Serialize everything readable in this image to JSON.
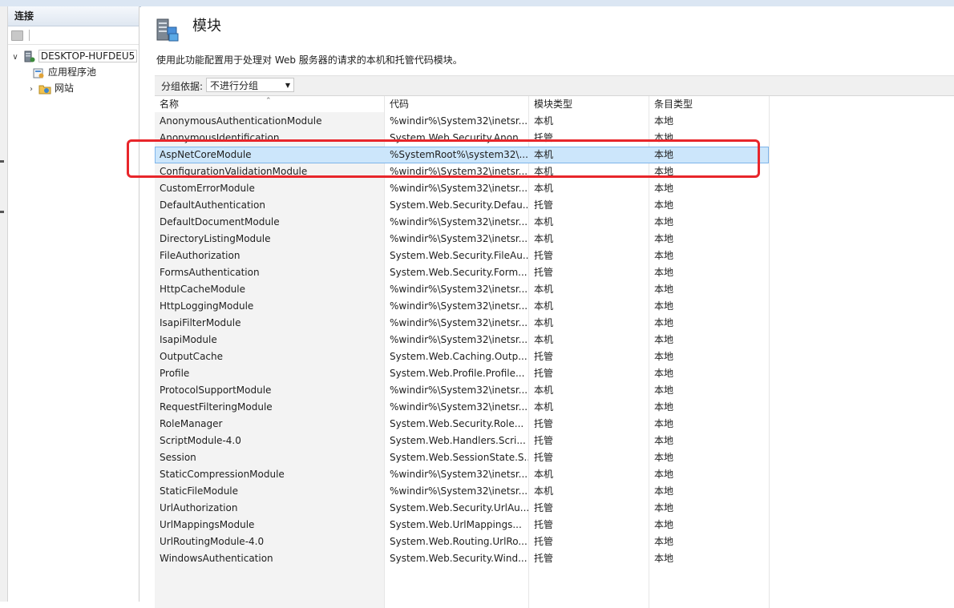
{
  "connections": {
    "title": "连接",
    "tree": [
      {
        "label": "DESKTOP-HUFDEU5",
        "expander": "∨"
      },
      {
        "label": "应用程序池",
        "expander": ""
      },
      {
        "label": "网站",
        "expander": "›"
      }
    ]
  },
  "page": {
    "title": "模块",
    "description": "使用此功能配置用于处理对 Web 服务器的请求的本机和托管代码模块。"
  },
  "grouping": {
    "label": "分组依据:",
    "selected": "不进行分组",
    "arrow": "▼"
  },
  "table": {
    "columns": [
      "名称",
      "代码",
      "模块类型",
      "条目类型"
    ],
    "sort_indicator": "⌃",
    "rows": [
      {
        "name": "AnonymousAuthenticationModule",
        "code": "%windir%\\System32\\inetsr...",
        "module_type": "本机",
        "entry_type": "本地"
      },
      {
        "name": "AnonymousIdentification",
        "code": "System.Web.Security.Anon...",
        "module_type": "托管",
        "entry_type": "本地"
      },
      {
        "name": "AspNetCoreModule",
        "code": "%SystemRoot%\\system32\\...",
        "module_type": "本机",
        "entry_type": "本地"
      },
      {
        "name": "ConfigurationValidationModule",
        "code": "%windir%\\System32\\inetsr...",
        "module_type": "本机",
        "entry_type": "本地"
      },
      {
        "name": "CustomErrorModule",
        "code": "%windir%\\System32\\inetsr...",
        "module_type": "本机",
        "entry_type": "本地"
      },
      {
        "name": "DefaultAuthentication",
        "code": "System.Web.Security.Defau...",
        "module_type": "托管",
        "entry_type": "本地"
      },
      {
        "name": "DefaultDocumentModule",
        "code": "%windir%\\System32\\inetsr...",
        "module_type": "本机",
        "entry_type": "本地"
      },
      {
        "name": "DirectoryListingModule",
        "code": "%windir%\\System32\\inetsr...",
        "module_type": "本机",
        "entry_type": "本地"
      },
      {
        "name": "FileAuthorization",
        "code": "System.Web.Security.FileAu...",
        "module_type": "托管",
        "entry_type": "本地"
      },
      {
        "name": "FormsAuthentication",
        "code": "System.Web.Security.Form...",
        "module_type": "托管",
        "entry_type": "本地"
      },
      {
        "name": "HttpCacheModule",
        "code": "%windir%\\System32\\inetsr...",
        "module_type": "本机",
        "entry_type": "本地"
      },
      {
        "name": "HttpLoggingModule",
        "code": "%windir%\\System32\\inetsr...",
        "module_type": "本机",
        "entry_type": "本地"
      },
      {
        "name": "IsapiFilterModule",
        "code": "%windir%\\System32\\inetsr...",
        "module_type": "本机",
        "entry_type": "本地"
      },
      {
        "name": "IsapiModule",
        "code": "%windir%\\System32\\inetsr...",
        "module_type": "本机",
        "entry_type": "本地"
      },
      {
        "name": "OutputCache",
        "code": "System.Web.Caching.Outp...",
        "module_type": "托管",
        "entry_type": "本地"
      },
      {
        "name": "Profile",
        "code": "System.Web.Profile.Profile...",
        "module_type": "托管",
        "entry_type": "本地"
      },
      {
        "name": "ProtocolSupportModule",
        "code": "%windir%\\System32\\inetsr...",
        "module_type": "本机",
        "entry_type": "本地"
      },
      {
        "name": "RequestFilteringModule",
        "code": "%windir%\\System32\\inetsr...",
        "module_type": "本机",
        "entry_type": "本地"
      },
      {
        "name": "RoleManager",
        "code": "System.Web.Security.Role...",
        "module_type": "托管",
        "entry_type": "本地"
      },
      {
        "name": "ScriptModule-4.0",
        "code": "System.Web.Handlers.Scri...",
        "module_type": "托管",
        "entry_type": "本地"
      },
      {
        "name": "Session",
        "code": "System.Web.SessionState.S...",
        "module_type": "托管",
        "entry_type": "本地"
      },
      {
        "name": "StaticCompressionModule",
        "code": "%windir%\\System32\\inetsr...",
        "module_type": "本机",
        "entry_type": "本地"
      },
      {
        "name": "StaticFileModule",
        "code": "%windir%\\System32\\inetsr...",
        "module_type": "本机",
        "entry_type": "本地"
      },
      {
        "name": "UrlAuthorization",
        "code": "System.Web.Security.UrlAu...",
        "module_type": "托管",
        "entry_type": "本地"
      },
      {
        "name": "UrlMappingsModule",
        "code": "System.Web.UrlMappings...",
        "module_type": "托管",
        "entry_type": "本地"
      },
      {
        "name": "UrlRoutingModule-4.0",
        "code": "System.Web.Routing.UrlRo...",
        "module_type": "托管",
        "entry_type": "本地"
      },
      {
        "name": "WindowsAuthentication",
        "code": "System.Web.Security.Wind...",
        "module_type": "托管",
        "entry_type": "本地"
      }
    ]
  },
  "colors": {
    "selection": "#cce6fb",
    "annotation": "#e8262b"
  },
  "icons": [
    "server-icon",
    "app-pool-icon",
    "sites-folder-icon",
    "modules-icon"
  ]
}
